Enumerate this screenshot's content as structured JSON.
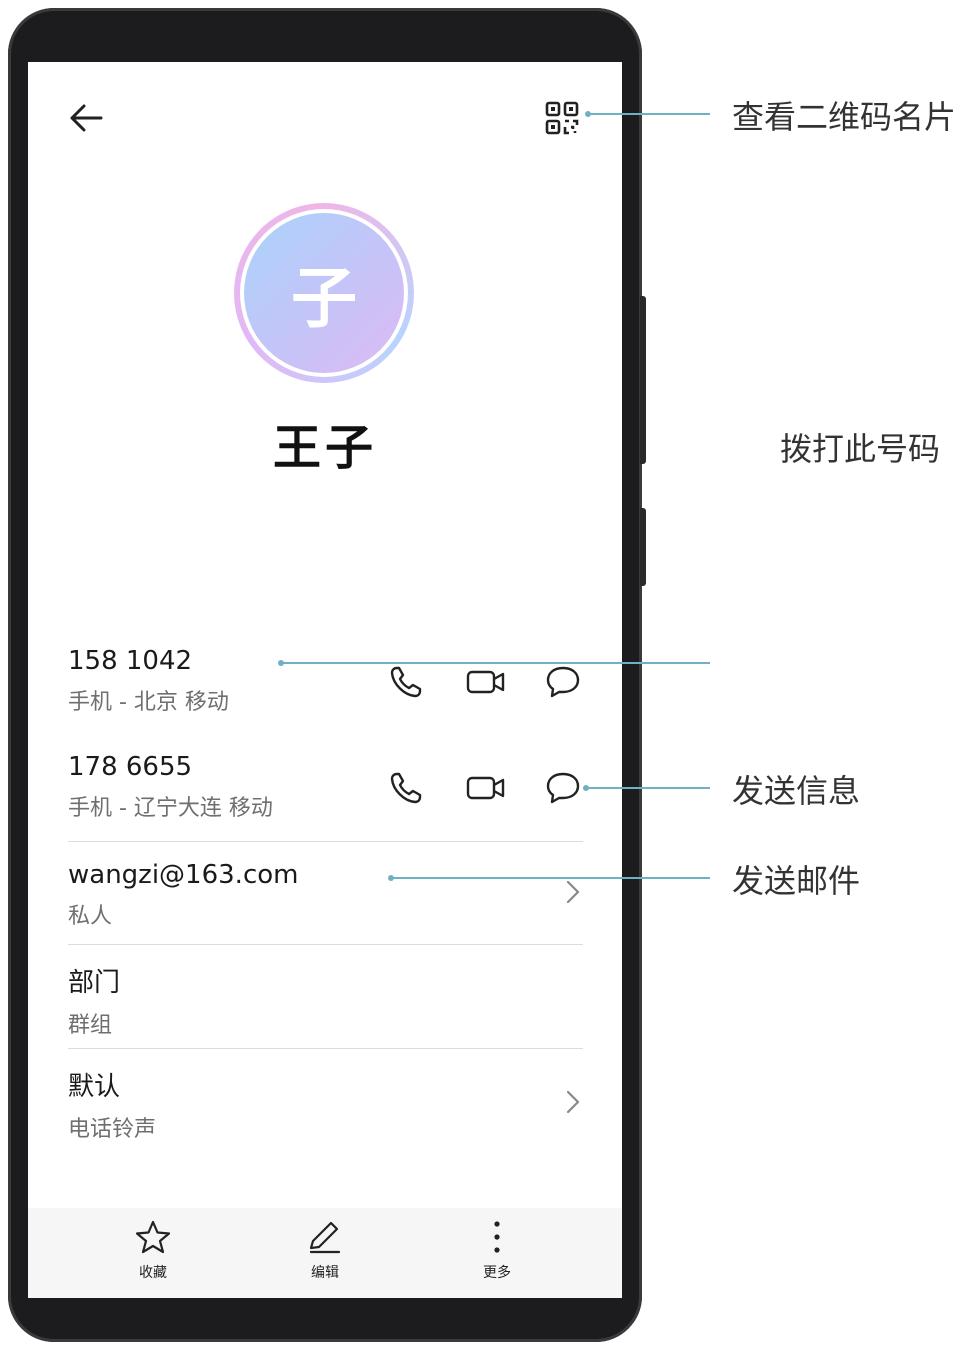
{
  "contact": {
    "avatar_char": "子",
    "name": "王子",
    "phones": [
      {
        "number": "158 1042",
        "label": "手机 - 北京 移动"
      },
      {
        "number": "178 6655",
        "label": "手机 - 辽宁大连 移动"
      }
    ],
    "email": {
      "address": "wangzi@163.com",
      "label": "私人"
    },
    "department": {
      "value": "部门",
      "label": "群组"
    },
    "ringtone": {
      "value": "默认",
      "label": "电话铃声"
    }
  },
  "bottom_bar": {
    "favorite_label": "收藏",
    "edit_label": "编辑",
    "more_label": "更多"
  },
  "annotations": {
    "qr_card": "查看二维码名片",
    "dial": "拨打此号码",
    "message": "发送信息",
    "mail": "发送邮件"
  },
  "colors": {
    "annotation_line": "#6fb0c4",
    "avatar_gradient_start": "#a9d3fb",
    "avatar_gradient_end": "#dcbaf3"
  },
  "icons": [
    "back-arrow-icon",
    "qr-code-icon",
    "phone-icon",
    "video-call-icon",
    "message-icon",
    "chevron-right-icon",
    "star-icon",
    "pencil-icon",
    "more-vertical-icon"
  ]
}
